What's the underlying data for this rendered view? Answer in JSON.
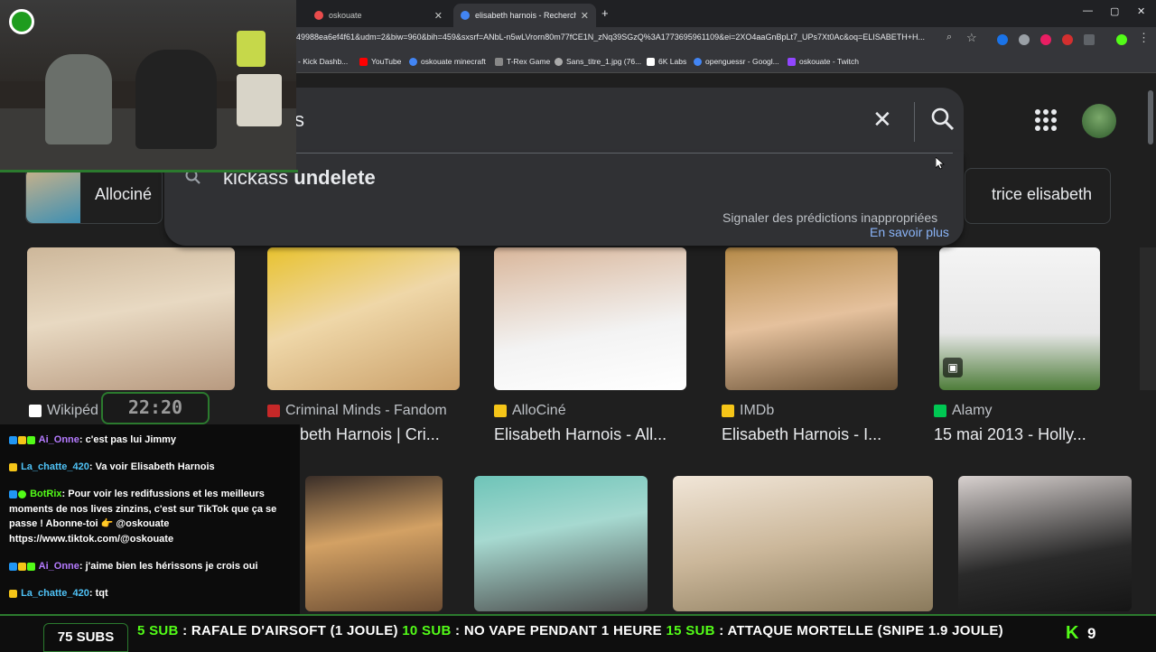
{
  "browser": {
    "tabs": [
      {
        "label": "oskouate",
        "favicon_color": "#ea4c4c"
      },
      {
        "label": "elisabeth harnois - Recherche G",
        "favicon_color": "#4285f4"
      }
    ],
    "new_tab": "+",
    "window_controls": [
      "—",
      "▢",
      "✕"
    ],
    "url": "49988ea6ef4f61&udm=2&biw=960&bih=459&sxsrf=ANbL-n5wLVrorn80m77fCE1N_zNq39SGzQ%3A1773695961109&ei=2XO4aaGnBpLt7_UPs7Xt0Ac&oq=ELISABETH+H...",
    "bookmarks": [
      {
        "label": "- Kick Dashb...",
        "color": "#53fc18"
      },
      {
        "label": "YouTube",
        "color": "#ff0000"
      },
      {
        "label": "oskouate minecraft",
        "color": "#4285f4"
      },
      {
        "label": "T-Rex Game",
        "color": "#888888"
      },
      {
        "label": "Sans_titre_1.jpg (76...",
        "color": "#aaaaaa"
      },
      {
        "label": "6K Labs",
        "color": "#ffffff"
      },
      {
        "label": "openguessr - Googl...",
        "color": "#4285f4"
      },
      {
        "label": "oskouate - Twitch",
        "color": "#9146ff"
      }
    ]
  },
  "search": {
    "query_fragment": "s",
    "suggestion_prefix": "kickass ",
    "suggestion_bold": "undelete",
    "report_text": "Signaler des prédictions inappropriées",
    "learn_more": "En savoir plus",
    "chip_left": "Allociné",
    "chip_right": "trice elisabeth"
  },
  "results_row1": [
    {
      "source": "Wikipéd",
      "title": "",
      "favicon": "#ffffff"
    },
    {
      "source": "Criminal Minds - Fandom",
      "title": "beth Harnois | Cri...",
      "favicon": "#c62828"
    },
    {
      "source": "AlloCiné",
      "title": "Elisabeth Harnois - All...",
      "favicon": "#f5c518"
    },
    {
      "source": "IMDb",
      "title": "Elisabeth Harnois - I...",
      "favicon": "#f5c518"
    },
    {
      "source": "Alamy",
      "title": "15 mai 2013 - Holly...",
      "favicon": "#00c853"
    }
  ],
  "stream": {
    "clock": "22:20",
    "chat": [
      {
        "user": "Ai_Onne",
        "user_color": "#b57bff",
        "text": ": c'est pas lui Jimmy"
      },
      {
        "user": "La_chatte_420",
        "user_color": "#4fc3f7",
        "text": ": Va voir Elisabeth Harnois"
      },
      {
        "user": "BotRix",
        "user_color": "#53fc18",
        "text": ": Pour voir les redifussions et les meilleurs moments de nos lives zinzins, c'est sur TikTok que ça se passe ! Abonne-toi 👉 @oskouate https://www.tiktok.com/@oskouate"
      },
      {
        "user": "Ai_Onne",
        "user_color": "#b57bff",
        "text": ": j'aime bien les hérissons je crois oui"
      },
      {
        "user": "La_chatte_420",
        "user_color": "#4fc3f7",
        "text": ": tqt"
      }
    ],
    "subs_label": "75 SUBS",
    "ticker": [
      {
        "g": "5 SUB",
        "t": " : RAFALE D'AIRSOFT (1 JOULE) "
      },
      {
        "g": "10 SUB",
        "t": " : NO VAPE PENDANT 1 HEURE "
      },
      {
        "g": "15 SUB",
        "t": " : ATTAQUE MORTELLE (SNIPE 1.9 JOULE)"
      }
    ],
    "kick_letter": "K",
    "viewer_count": "9"
  }
}
